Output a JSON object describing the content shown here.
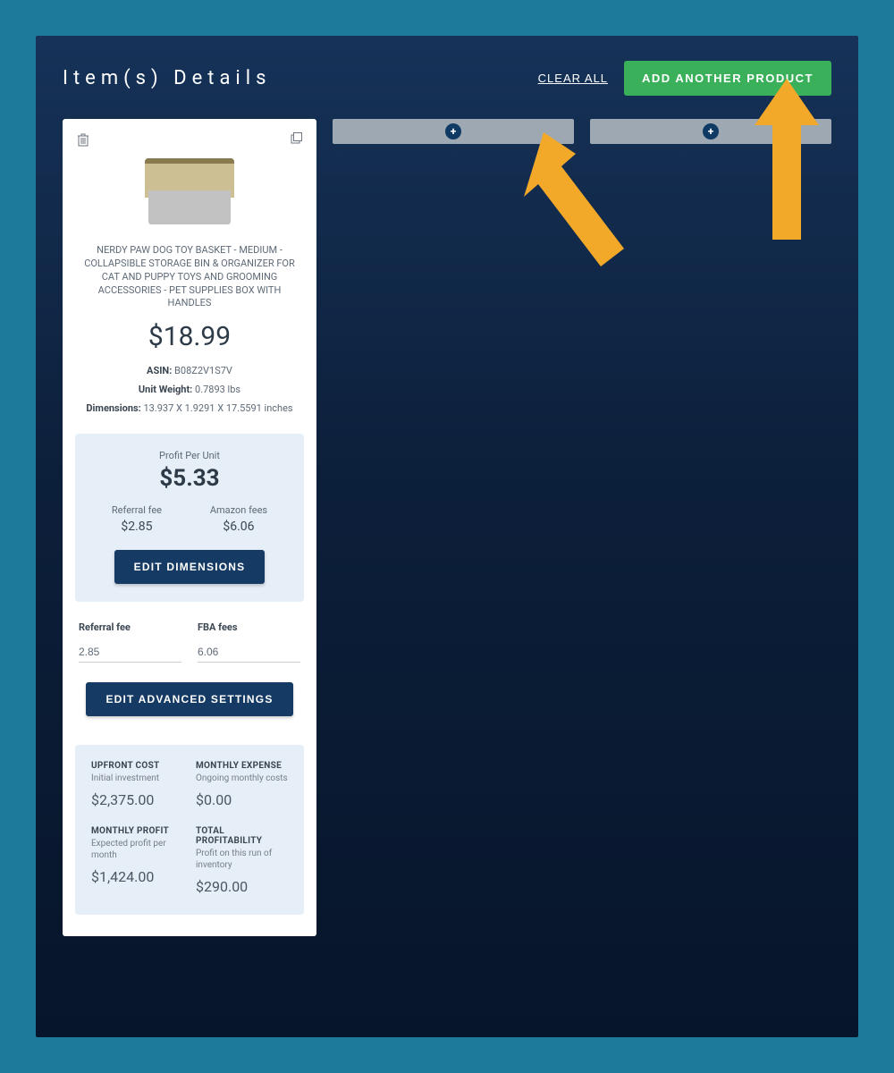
{
  "header": {
    "title": "Item(s) Details",
    "clear_all": "CLEAR ALL",
    "add_another": "ADD ANOTHER PRODUCT"
  },
  "product": {
    "title": "NERDY PAW DOG TOY BASKET - MEDIUM - COLLAPSIBLE STORAGE BIN & ORGANIZER FOR CAT AND PUPPY TOYS AND GROOMING ACCESSORIES - PET SUPPLIES BOX WITH HANDLES",
    "price": "$18.99",
    "asin_label": "ASIN:",
    "asin_value": "B08Z2V1S7V",
    "weight_label": "Unit Weight:",
    "weight_value": "0.7893 lbs",
    "dimensions_label": "Dimensions:",
    "dimensions_value": "13.937 X 1.9291 X 17.5591 inches"
  },
  "profit": {
    "label": "Profit Per Unit",
    "value": "$5.33",
    "referral_label": "Referral fee",
    "referral_value": "$2.85",
    "amazon_label": "Amazon fees",
    "amazon_value": "$6.06",
    "edit_dimensions": "EDIT DIMENSIONS"
  },
  "inputs": {
    "referral_label": "Referral fee",
    "referral_value": "2.85",
    "fba_label": "FBA fees",
    "fba_value": "6.06",
    "edit_advanced": "EDIT ADVANCED SETTINGS"
  },
  "summary": {
    "upfront_title": "UPFRONT COST",
    "upfront_sub": "Initial investment",
    "upfront_value": "$2,375.00",
    "monthly_exp_title": "MONTHLY EXPENSE",
    "monthly_exp_sub": "Ongoing monthly costs",
    "monthly_exp_value": "$0.00",
    "monthly_profit_title": "MONTHLY PROFIT",
    "monthly_profit_sub": "Expected profit per month",
    "monthly_profit_value": "$1,424.00",
    "total_title": "TOTAL PROFITABILITY",
    "total_sub": "Profit on this run of inventory",
    "total_value": "$290.00"
  }
}
